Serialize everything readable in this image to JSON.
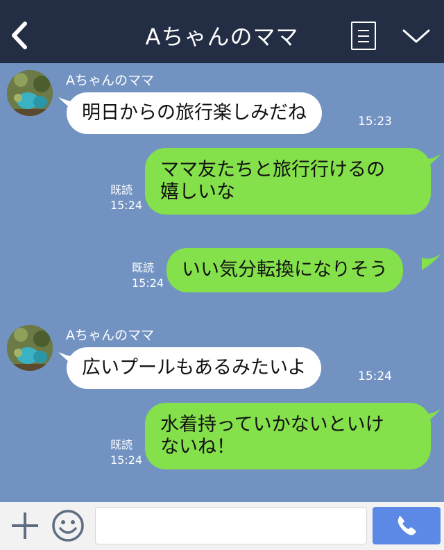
{
  "header": {
    "title": "Aちゃんのママ",
    "back_icon": "chevron-left-icon",
    "menu_icon": "list-icon",
    "more_icon": "chevron-down-icon"
  },
  "messages": [
    {
      "sender": "Aちゃんのママ",
      "text": "明日からの旅行楽しみだね",
      "time": "15:23",
      "direction": "incoming"
    },
    {
      "text_line1": "ママ友たちと旅行行けるの",
      "text_line2": "嬉しいな",
      "read": "既読",
      "time": "15:24",
      "direction": "outgoing"
    },
    {
      "text": "いい気分転換になりそう",
      "read": "既読",
      "time": "15:24",
      "direction": "outgoing"
    },
    {
      "sender": "Aちゃんのママ",
      "text": "広いプールもあるみたいよ",
      "time": "15:24",
      "direction": "incoming"
    },
    {
      "text_line1": "水着持っていかないといけ",
      "text_line2": "ないね！",
      "read": "既読",
      "time": "15:24",
      "direction": "outgoing"
    }
  ],
  "composer": {
    "value": "",
    "plus_icon": "plus-icon",
    "emoji_icon": "smiley-icon",
    "call_icon": "phone-icon"
  },
  "colors": {
    "header_bg": "#232d44",
    "chat_bg": "#7293c2",
    "incoming_bubble": "#ffffff",
    "outgoing_bubble": "#84e04b",
    "call_button": "#5c88e6"
  }
}
